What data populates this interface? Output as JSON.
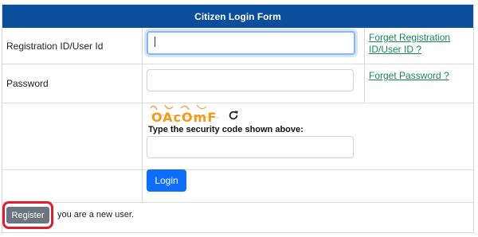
{
  "form": {
    "title": "Citizen Login Form"
  },
  "fields": {
    "user_id": {
      "label": "Registration ID/User Id",
      "value": "",
      "placeholder": ""
    },
    "password": {
      "label": "Password",
      "value": "",
      "placeholder": ""
    },
    "captcha_answer": {
      "value": "",
      "placeholder": ""
    }
  },
  "links": {
    "forgot_registration_line1": "Forget Registration",
    "forgot_registration_line2": "ID/User ID ?",
    "forgot_password": "Forget Password ?"
  },
  "captcha": {
    "code": "OAcOmF",
    "instruction": "Type the security code shown above:",
    "refresh_icon": "refresh-icon"
  },
  "buttons": {
    "login": "Login",
    "register": "Register"
  },
  "register_note": "you are a new user.",
  "colors": {
    "header_bg": "#0b4f9c",
    "link": "#198754",
    "login_bg": "#0d6efd",
    "register_bg": "#6c757d",
    "highlight": "#e21b2d",
    "captcha_text": "#f39a1b"
  }
}
